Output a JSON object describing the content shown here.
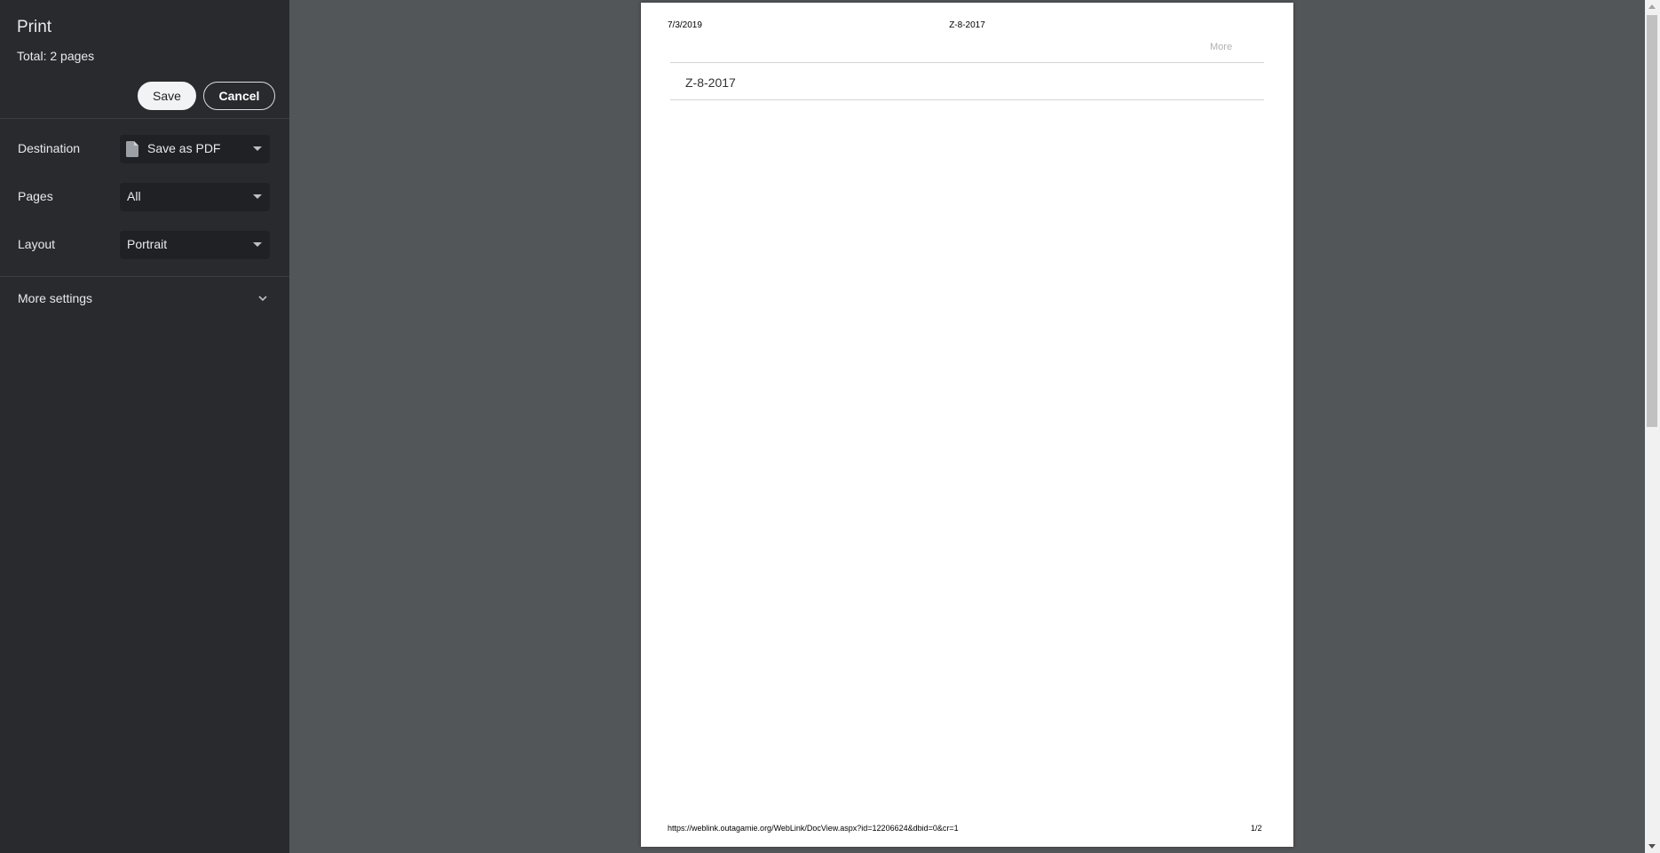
{
  "sidebar": {
    "title": "Print",
    "total": "Total: 2 pages",
    "save_label": "Save",
    "cancel_label": "Cancel",
    "settings": {
      "destination": {
        "label": "Destination",
        "value": "Save as PDF",
        "icon": "pdf-file-icon"
      },
      "pages": {
        "label": "Pages",
        "value": "All"
      },
      "layout": {
        "label": "Layout",
        "value": "Portrait"
      }
    },
    "more_settings": {
      "label": "More settings",
      "icon": "chevron-down-icon"
    }
  },
  "preview": {
    "page": {
      "header_date": "7/3/2019",
      "header_title": "Z-8-2017",
      "more_link": "More",
      "doc_title": "Z-8-2017",
      "footer_url": "https://weblink.outagamie.org/WebLink/DocView.aspx?id=12206624&dbid=0&cr=1",
      "page_number": "1/2"
    }
  },
  "colors": {
    "sidebar_bg": "#292a2d",
    "select_bg": "#202124",
    "preview_bg": "#525659",
    "page_bg": "#ffffff"
  }
}
